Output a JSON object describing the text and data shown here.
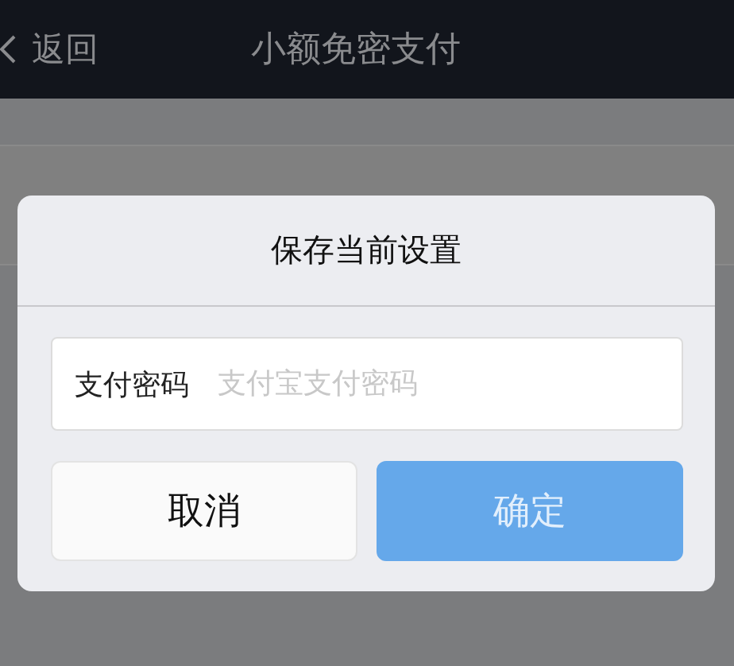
{
  "nav_bar": {
    "back_label": "返回",
    "title": "小额免密支付"
  },
  "dialog": {
    "title": "保存当前设置",
    "field": {
      "label": "支付密码",
      "placeholder": "支付宝支付密码"
    },
    "buttons": [
      {
        "label": "取消",
        "kind": "cancel",
        "disabled": false
      },
      {
        "label": "确定",
        "kind": "confirm",
        "disabled": true
      }
    ]
  }
}
